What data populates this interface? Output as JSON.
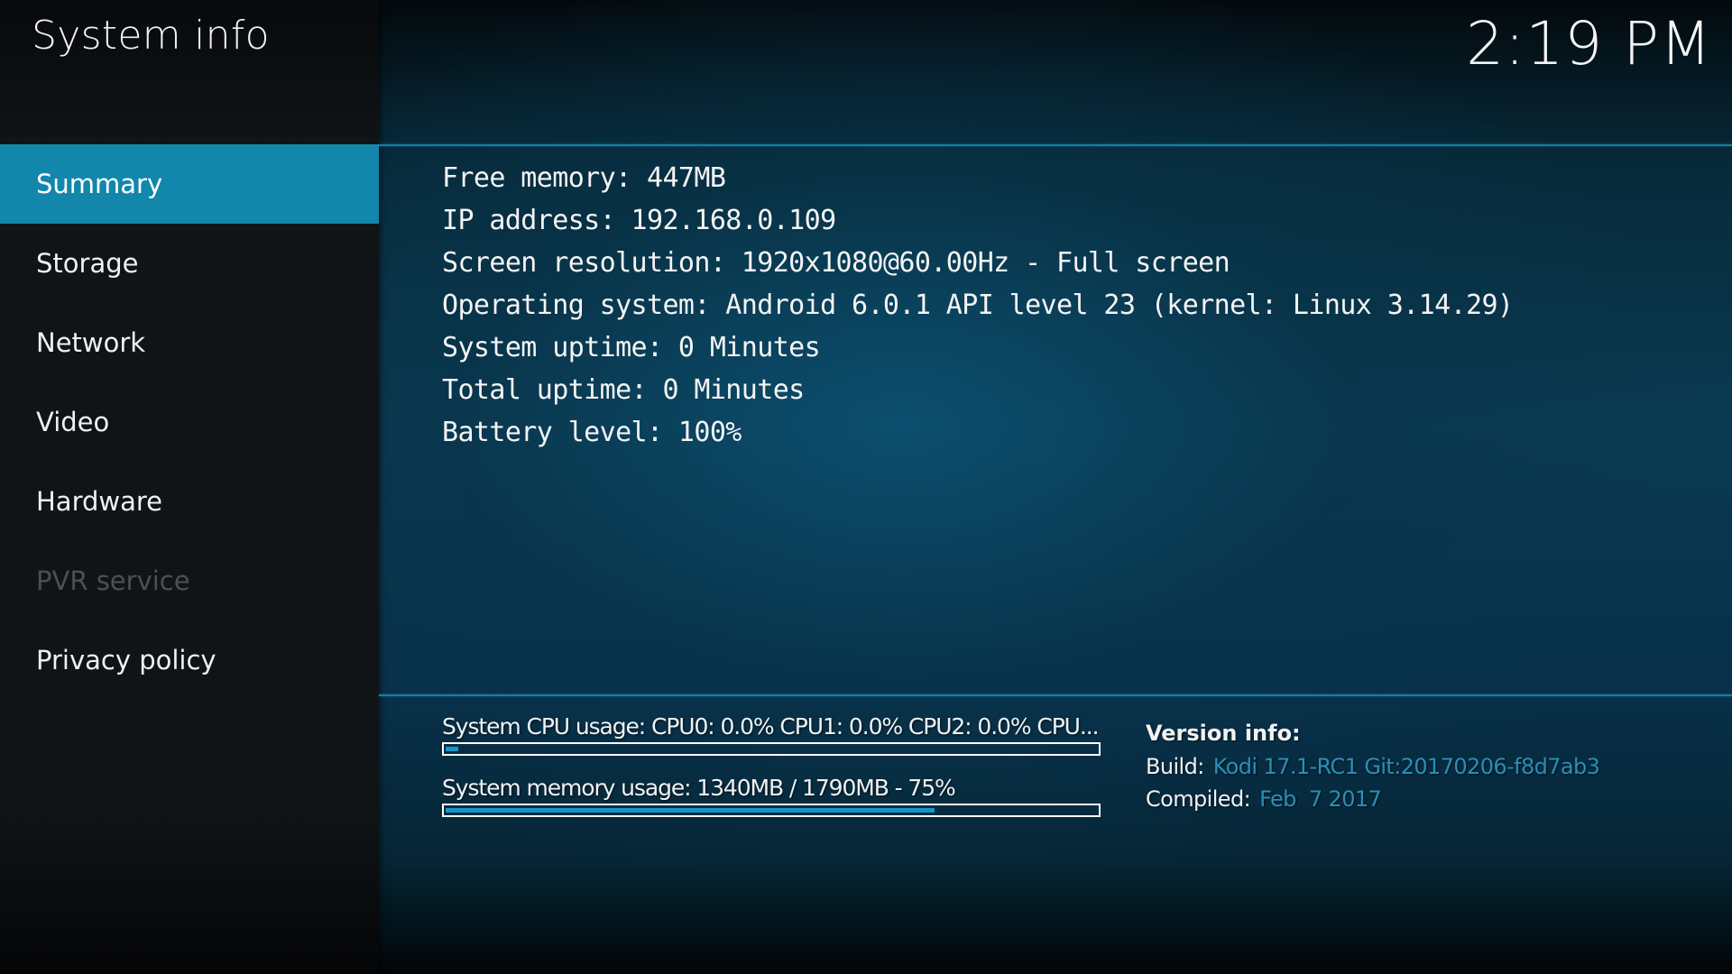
{
  "header": {
    "title": "System info",
    "clock": "2:19 PM"
  },
  "sidebar": {
    "items": [
      {
        "label": "Summary",
        "state": "active"
      },
      {
        "label": "Storage",
        "state": "normal"
      },
      {
        "label": "Network",
        "state": "normal"
      },
      {
        "label": "Video",
        "state": "normal"
      },
      {
        "label": "Hardware",
        "state": "normal"
      },
      {
        "label": "PVR service",
        "state": "disabled"
      },
      {
        "label": "Privacy policy",
        "state": "normal"
      }
    ]
  },
  "summary": {
    "lines": [
      "Free memory: 447MB",
      "IP address: 192.168.0.109",
      "Screen resolution: 1920x1080@60.00Hz - Full screen",
      "Operating system: Android 6.0.1 API level 23 (kernel: Linux 3.14.29)",
      "System uptime: 0 Minutes",
      "Total uptime: 0 Minutes",
      "Battery level: 100%"
    ]
  },
  "usage": {
    "cpu": {
      "label": "System CPU usage: CPU0: 0.0% CPU1: 0.0% CPU2: 0.0% CPU...",
      "percent": 2
    },
    "memory": {
      "label": "System memory usage: 1340MB / 1790MB - 75%",
      "percent": 75
    }
  },
  "version": {
    "title": "Version info:",
    "build_key": "Build:",
    "build_value": "Kodi 17.1-RC1 Git:20170206-f8d7ab3",
    "compiled_key": "Compiled:",
    "compiled_value": "Feb  7 2017"
  },
  "colors": {
    "accent": "#1287ab",
    "bar_fill": "#1596c8",
    "version_value": "#2a8fb5",
    "disabled_text": "#4a5054"
  }
}
